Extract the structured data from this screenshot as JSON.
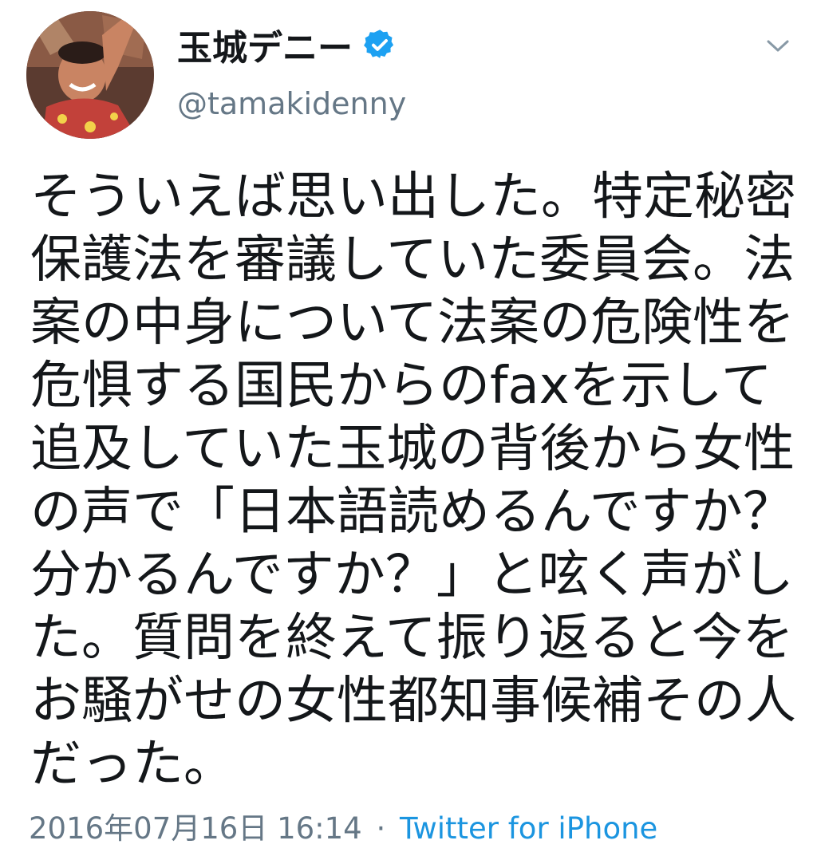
{
  "user": {
    "display_name": "玉城デニー",
    "handle": "@tamakidenny",
    "verified": true,
    "avatar_icon": "profile-photo"
  },
  "tweet": {
    "lines": [
      "そういえば思い出した。特定秘密",
      "保護法を審議していた委員会。法",
      "案の中身について法案の危険性を",
      "危惧する国民からのfaxを示して",
      "追及していた玉城の背後から女性",
      "の声で「日本語読めるんですか？",
      "分かるんですか？」と呟く声がし",
      "た。質問を終えて振り返ると今を",
      "お騒がせの女性都知事候補その人",
      "だった。"
    ]
  },
  "meta": {
    "timestamp": "2016年07月16日 16:14",
    "separator": "·",
    "source": "Twitter for iPhone"
  },
  "colors": {
    "text": "#14171a",
    "secondary": "#657786",
    "link": "#1b95e0",
    "verified_badge": "#1da1f2"
  },
  "icons": {
    "verified": "verified-badge-icon",
    "more": "chevron-down-icon"
  }
}
